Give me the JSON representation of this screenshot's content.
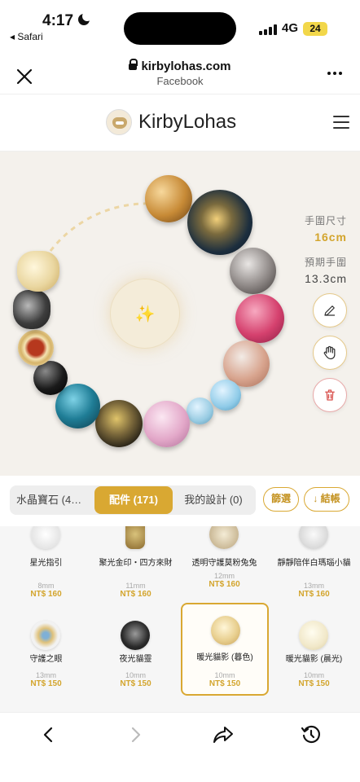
{
  "status": {
    "time": "4:17",
    "back_app": "◂ Safari",
    "network": "4G",
    "battery": "24"
  },
  "browser": {
    "url": "kirbylohas.com",
    "subtitle": "Facebook"
  },
  "site": {
    "brand": "KirbyLohas"
  },
  "stage": {
    "size_label": "手圍尺寸",
    "size_value": "16cm",
    "expected_label": "預期手圍",
    "expected_value": "13.3cm",
    "center_glyph": "✨"
  },
  "tabs": {
    "crystal": "水晶寶石 (4…",
    "accessories": "配件 (171)",
    "my_designs": "我的設計 (0)",
    "filter": "篩選",
    "checkout": "↓ 結帳"
  },
  "products": [
    {
      "name": "星光指引",
      "size": "8mm",
      "price": "NT$ 160"
    },
    {
      "name": "聚光金印・四方來財",
      "size": "11mm",
      "price": "NT$ 160"
    },
    {
      "name": "透明守護莫粉兔兔",
      "size": "12mm",
      "price": "NT$ 160"
    },
    {
      "name": "靜靜陪伴白瑪瑙小貓",
      "size": "13mm",
      "price": "NT$ 160"
    },
    {
      "name": "守護之眼",
      "size": "13mm",
      "price": "NT$ 150"
    },
    {
      "name": "夜光貓靈",
      "size": "10mm",
      "price": "NT$ 150"
    },
    {
      "name": "暖光貓影 (暮色)",
      "size": "10mm",
      "price": "NT$ 150"
    },
    {
      "name": "暖光貓影 (晨光)",
      "size": "10mm",
      "price": "NT$ 150"
    }
  ],
  "colors": {
    "gold": "#d9a832",
    "price_gold": "#d3a52d",
    "stage_bg": "#f4f1ec",
    "delete_red": "#d9534f"
  }
}
